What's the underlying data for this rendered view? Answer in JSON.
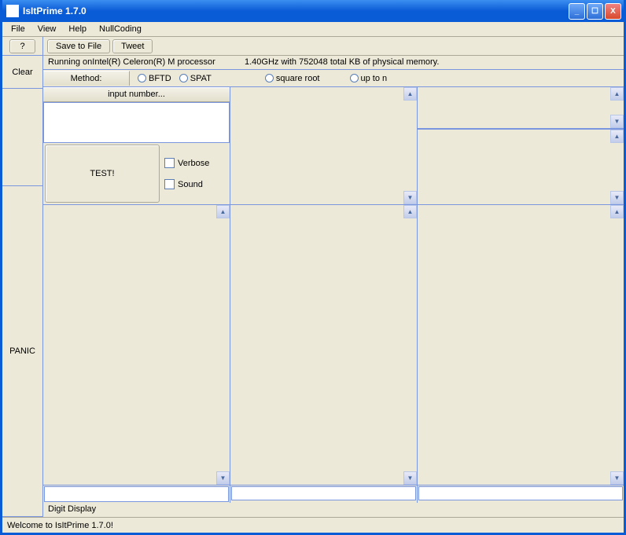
{
  "title": "IsItPrime 1.7.0",
  "menu": {
    "file": "File",
    "view": "View",
    "help": "Help",
    "nullcoding": "NullCoding"
  },
  "toolbar": {
    "help": "?",
    "save": "Save to File",
    "tweet": "Tweet"
  },
  "sidebar": {
    "clear": "Clear",
    "panic": "PANIC"
  },
  "status": {
    "proc": "Running onIntel(R) Celeron(R) M processor",
    "mem": "1.40GHz with 752048 total KB of physical memory."
  },
  "method": {
    "label": "Method:",
    "bftd": "BFTD",
    "spat": "SPAT",
    "sqrt": "square root",
    "upton": "up to n"
  },
  "input": {
    "header": "input number..."
  },
  "test": {
    "label": "TEST!",
    "verbose": "Verbose",
    "sound": "Sound"
  },
  "digit": "Digit Display",
  "statusbar": "Welcome to IsItPrime 1.7.0!"
}
